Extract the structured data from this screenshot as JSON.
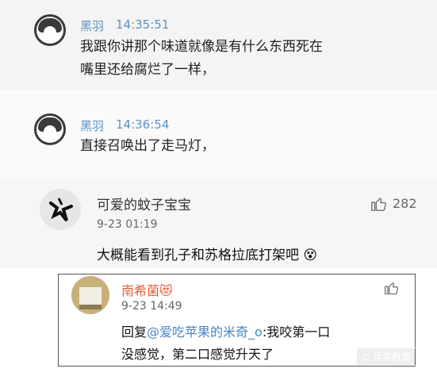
{
  "messages": [
    {
      "name": "黑羽",
      "time": "14:35:51",
      "lines": [
        "我跟你讲那个味道就像是有什么东西死在",
        "嘴里还给腐烂了一样，"
      ]
    },
    {
      "name": "黑羽",
      "time": "14:36:54",
      "lines": [
        "直接召唤出了走马灯，"
      ]
    }
  ],
  "comment": {
    "name": "可爱的蚊子宝宝",
    "date": "9-23 01:19",
    "text": "大概能看到孔子和苏格拉底打架吧",
    "likes": "282",
    "emoji": "😵"
  },
  "reply": {
    "name": "南希菌",
    "badge": "😻",
    "date": "9-23 14:49",
    "prefix": "回复",
    "mention": "@爱吃苹果的米奇_o",
    "text1": ":我咬第一口",
    "text2": "没感觉，第二口感觉升天了"
  },
  "watermark": "⊏ 兵学教育",
  "colors": {
    "name": "#5a93c8",
    "reply_name": "#e35c3b",
    "link": "#4a86c7"
  },
  "icons": [
    "thumbs-up-icon",
    "avatar"
  ]
}
